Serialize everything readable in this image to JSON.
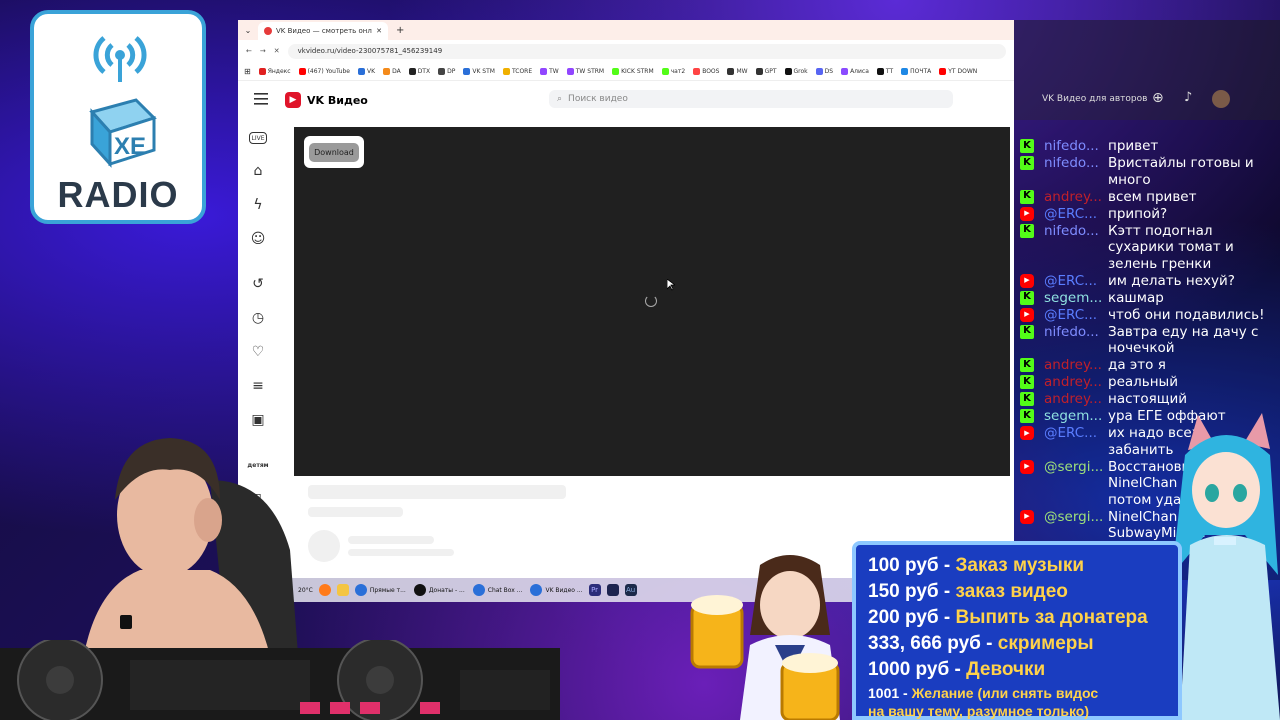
{
  "logo": {
    "text": "RADIO",
    "mark": "XE"
  },
  "browser": {
    "tab_title": "VK Видео — смотреть онлайн",
    "new_tab_label": "+",
    "url": "vkvideo.ru/video-230075781_456239149",
    "bookmarks": [
      {
        "label": "Яндекс",
        "color": "#e02020"
      },
      {
        "label": "(467) YouTube",
        "color": "#ff0000"
      },
      {
        "label": "VK",
        "color": "#2a6fd8"
      },
      {
        "label": "DA",
        "color": "#f48a1a"
      },
      {
        "label": "DTX",
        "color": "#222222"
      },
      {
        "label": "DP",
        "color": "#444444"
      },
      {
        "label": "VK STM",
        "color": "#2a6fd8"
      },
      {
        "label": "TCORE",
        "color": "#f0b000"
      },
      {
        "label": "TW",
        "color": "#9146ff"
      },
      {
        "label": "TW STRM",
        "color": "#9146ff"
      },
      {
        "label": "KICK STRM",
        "color": "#53fc18"
      },
      {
        "label": "чат2",
        "color": "#53fc18"
      },
      {
        "label": "BOOS",
        "color": "#f44"
      },
      {
        "label": "MW",
        "color": "#333"
      },
      {
        "label": "GPT",
        "color": "#333"
      },
      {
        "label": "Grok",
        "color": "#111"
      },
      {
        "label": "DS",
        "color": "#5865f2"
      },
      {
        "label": "Алиса",
        "color": "#8a4bff"
      },
      {
        "label": "TT",
        "color": "#111"
      },
      {
        "label": "ПОЧТА",
        "color": "#1e88e5"
      },
      {
        "label": "YT DOWN",
        "color": "#f00"
      }
    ],
    "site_name": "VK Видео",
    "search_placeholder": "Поиск видео",
    "download_label": "Download",
    "sidebar_live_label": "LIVE",
    "sidebar_kids_label": "детям"
  },
  "dim_overlay": {
    "authors_label": "VK Видео для авторов"
  },
  "chat": [
    {
      "platform": "kick",
      "user": "nifedo...",
      "color": "#7e8cff",
      "text": "привет"
    },
    {
      "platform": "kick",
      "user": "nifedo...",
      "color": "#7e8cff",
      "text": "Вристайлы готовы и много"
    },
    {
      "platform": "kick",
      "user": "andrey...",
      "color": "#c0202a",
      "text": "всем привет"
    },
    {
      "platform": "yt",
      "user": "@ERC...",
      "color": "#5a7dff",
      "text": "припой?"
    },
    {
      "platform": "kick",
      "user": "nifedo...",
      "color": "#7e8cff",
      "text": "Кэтт подогнал сухарики томат и зелень гренки"
    },
    {
      "platform": "yt",
      "user": "@ERC...",
      "color": "#5a7dff",
      "text": "им делать нехуй?"
    },
    {
      "platform": "kick",
      "user": "segem...",
      "color": "#8fe0e0",
      "text": "кашмар"
    },
    {
      "platform": "yt",
      "user": "@ERC...",
      "color": "#5a7dff",
      "text": "чтоб они подавились!"
    },
    {
      "platform": "kick",
      "user": "nifedo...",
      "color": "#7e8cff",
      "text": "Завтра еду на дачу с ночечкой"
    },
    {
      "platform": "kick",
      "user": "andrey...",
      "color": "#c0202a",
      "text": "да это я"
    },
    {
      "platform": "kick",
      "user": "andrey...",
      "color": "#c0202a",
      "text": "реальный"
    },
    {
      "platform": "kick",
      "user": "andrey...",
      "color": "#c0202a",
      "text": "настоящий"
    },
    {
      "platform": "kick",
      "user": "segem...",
      "color": "#8fe0e0",
      "text": "ура ЕГЕ оффают"
    },
    {
      "platform": "yt",
      "user": "@ERC...",
      "color": "#5a7dff",
      "text": "их надо всех забанить"
    },
    {
      "platform": "yt",
      "user": "@sergi...",
      "color": "#9ee07a",
      "text": "Восстановить каналу NinelChan чтобы потом удалить?"
    },
    {
      "platform": "yt",
      "user": "@sergi...",
      "color": "#9ee07a",
      "text": "NinelChan - нет SubwayMinder"
    }
  ],
  "taskbar": {
    "weather": "20°C",
    "items": [
      {
        "label": "Прямые т...",
        "color": "#2a6fd8"
      },
      {
        "label": "Донаты - ...",
        "color": "#111"
      },
      {
        "label": "Chat Box ...",
        "color": "#2a6fd8"
      },
      {
        "label": "VK Видео ...",
        "color": "#2a6fd8"
      }
    ]
  },
  "donations": [
    {
      "price": "100 руб",
      "sep": " - ",
      "desc": "Заказ музыки"
    },
    {
      "price": "150 руб",
      "sep": " - ",
      "desc": "заказ видео"
    },
    {
      "price": "200 руб",
      "sep": " - ",
      "desc": "Выпить за донатера"
    },
    {
      "price": "333, 666 руб",
      "sep": " - ",
      "desc": "скримеры"
    },
    {
      "price": "1000 руб",
      "sep": " - ",
      "desc": "Девочки"
    }
  ],
  "donation_last": {
    "price": "1001",
    "sep": " - ",
    "desc": "Желание (или снять видос",
    "desc2": "на вашу тему, разумное только)"
  },
  "colors": {
    "accent_yellow": "#ffd24a",
    "panel_blue": "#1a3dc0",
    "vk_red": "#e0142a"
  }
}
